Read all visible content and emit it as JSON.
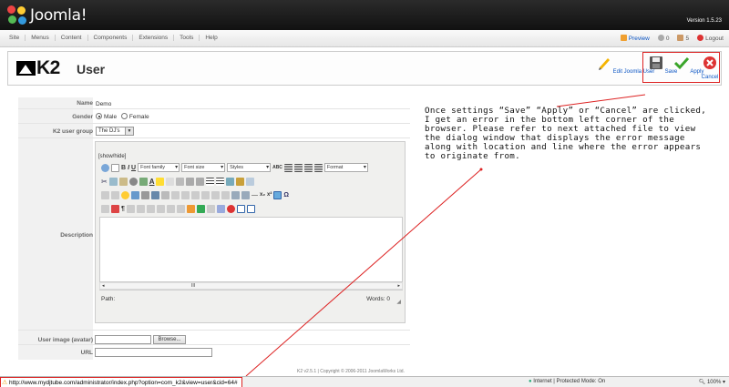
{
  "header": {
    "logo_text": "Joomla!",
    "version": "Version 1.5.23"
  },
  "menu": [
    "Site",
    "Menus",
    "Content",
    "Components",
    "Extensions",
    "Tools",
    "Help"
  ],
  "right_links": {
    "preview": "Preview",
    "messages": "0",
    "users": "5",
    "logout": "Logout"
  },
  "toolbar": {
    "k2_text": "K2",
    "title": "User",
    "edit_joomla_user": "Edit Joomla User",
    "save": "Save",
    "apply": "Apply",
    "cancel": "Cancel"
  },
  "form": {
    "name_label": "Name",
    "name_value": "Demo",
    "gender_label": "Gender",
    "gender_male": "Male",
    "gender_female": "Female",
    "gender_selected": "Male",
    "group_label": "K2 user group",
    "group_value": "The DJ's",
    "description_label": "Description",
    "avatar_label": "User image (avatar)",
    "browse_label": "Browse...",
    "url_label": "URL"
  },
  "editor": {
    "show_hide": "[show/hide]",
    "font_family": "Font family",
    "font_size": "Font size",
    "styles": "Styles",
    "format": "Format",
    "path_label": "Path:",
    "words": "Words: 0",
    "scroll_mark": "III"
  },
  "annotation": {
    "text": "Once settings “Save” “Apply” or “Cancel” are clicked, I get an error in the bottom left corner of the browser. Please refer to next attached file to view the dialog window that displays the error message along with location and line where the error appears to originate from."
  },
  "footer": {
    "text": "K2 v2.5.1 | Copyright © 2006-2011 JoomlaWorks Ltd."
  },
  "statusbar": {
    "url": "http://www.mydjtube.com/administrator/index.php?option=com_k2&view=user&cid=64#",
    "zone": "Internet | Protected Mode: On",
    "zoom": "100%"
  },
  "colors": {
    "header_bg": "#1a1a1a",
    "link_blue": "#0b55c4",
    "highlight_red": "#dd2222",
    "save_icon": "#555555",
    "apply_icon": "#3aa52a",
    "cancel_icon": "#d33333"
  }
}
